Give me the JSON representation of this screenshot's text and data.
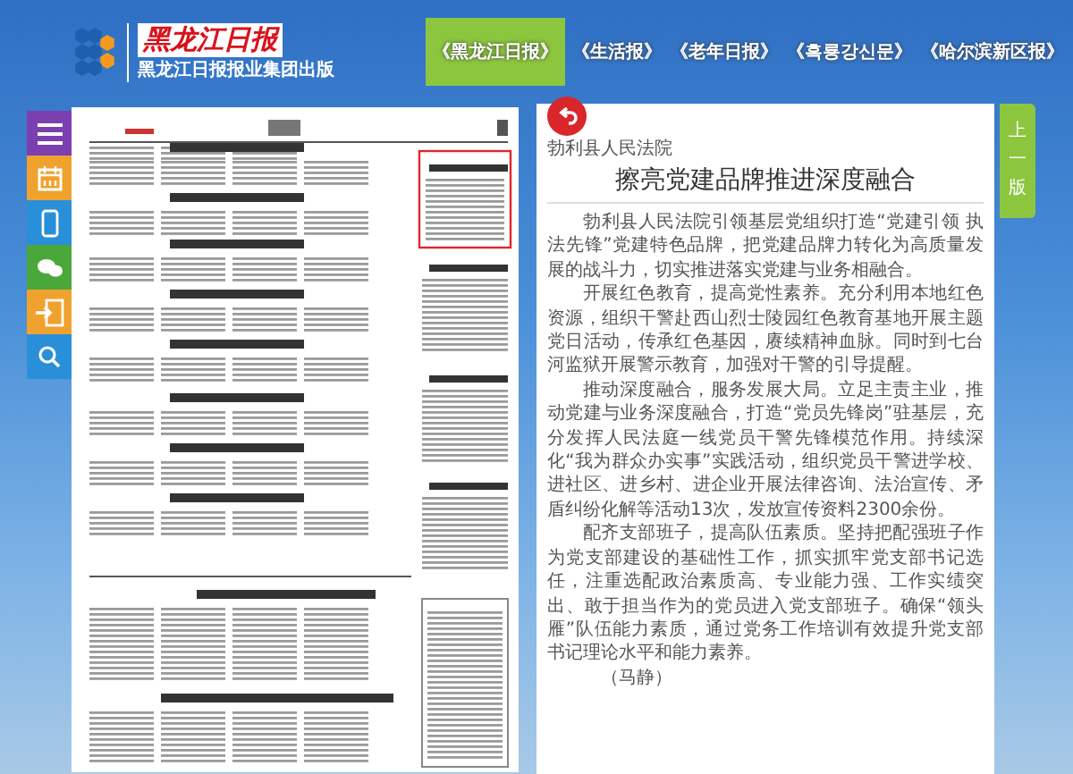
{
  "header": {
    "logo_title": "黑龙江日报",
    "logo_subtitle": "黑龙江日报报业集团出版"
  },
  "nav_tabs": [
    {
      "label": "《黑龙江日报》",
      "selected": true
    },
    {
      "label": "《生活报》",
      "selected": false
    },
    {
      "label": "《老年日报》",
      "selected": false
    },
    {
      "label": "《흑룡강신문》",
      "selected": false
    },
    {
      "label": "《哈尔滨新区报》",
      "selected": false
    }
  ],
  "article": {
    "source": "勃利县人民法院",
    "title": "擦亮党建品牌推进深度融合",
    "paragraphs": [
      "勃利县人民法院引领基层党组织打造“党建引领 执法先锋”党建特色品牌，把党建品牌力转化为高质量发展的战斗力，切实推进落实党建与业务相融合。",
      "开展红色教育，提高党性素养。充分利用本地红色资源，组织干警赴西山烈士陵园红色教育基地开展主题党日活动，传承红色基因，赓续精神血脉。同时到七台河监狱开展警示教育，加强对干警的引导提醒。",
      "推动深度融合，服务发展大局。立足主责主业，推动党建与业务深度融合，打造“党员先锋岗”驻基层，充分发挥人民法庭一线党员干警先锋模范作用。持续深化“我为群众办实事”实践活动，组织党员干警进学校、进社区、进乡村、进企业开展法律咨询、法治宣传、矛盾纠纷化解等活动13次，发放宣传资料2300余份。",
      "配齐支部班子，提高队伍素质。坚持把配强班子作为党支部建设的基础性工作，抓实抓牢党支部书记选任，注重选配政治素质高、专业能力强、工作实绩突出、敢于担当作为的党员进入党支部班子。确保“领头雁”队伍能力素质，通过党务工作培训有效提升党支部书记理论水平和能力素养。"
    ],
    "byline": "（马静）"
  },
  "page_nav": {
    "label": "上一版"
  }
}
